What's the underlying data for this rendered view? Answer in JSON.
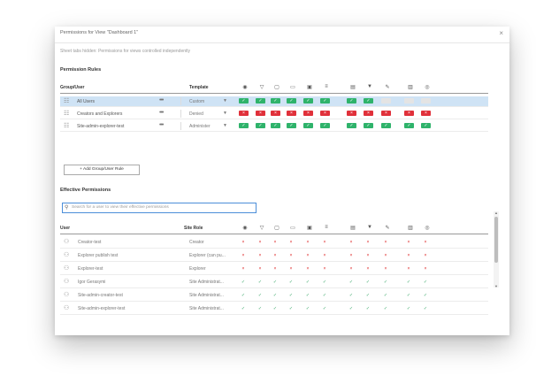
{
  "dialog": {
    "title": "Permissions for View \"Dashboard 1\"",
    "close_label": "×",
    "note": "Sheet tabs hidden: Permissions for views controlled independently"
  },
  "rules": {
    "section_title": "Permission Rules",
    "col_group": "Group/User",
    "col_template": "Template",
    "more_label": "•••",
    "caret": "▼",
    "capability_icons": [
      "view-icon",
      "filter-icon",
      "comment-icon",
      "add-comment-icon",
      "download-image-icon",
      "download-summary-icon",
      "download-full-data-icon",
      "share-icon",
      "web-edit-icon",
      "delete-icon",
      "set-permissions-icon"
    ],
    "rows": [
      {
        "name": "All Users",
        "template": "Custom",
        "selected": true,
        "caps": [
          "allow",
          "allow",
          "allow",
          "allow",
          "allow",
          "allow",
          "allow",
          "allow",
          "none",
          "none",
          "none"
        ]
      },
      {
        "name": "Creators and Explorers",
        "template": "Denied",
        "selected": false,
        "caps": [
          "deny",
          "deny",
          "deny",
          "deny",
          "deny",
          "deny",
          "deny",
          "deny",
          "deny",
          "deny",
          "deny"
        ]
      },
      {
        "name": "Site-admin-explorer-test",
        "template": "Administer",
        "selected": false,
        "caps": [
          "allow",
          "allow",
          "allow",
          "allow",
          "allow",
          "allow",
          "allow",
          "allow",
          "allow",
          "allow",
          "allow"
        ]
      }
    ],
    "add_button": "+ Add Group/User Rule"
  },
  "effective": {
    "section_title": "Effective Permissions",
    "search_placeholder": "Search for a user to view their effective permissions",
    "col_user": "User",
    "col_role": "Site Role",
    "rows": [
      {
        "name": "Creator-test",
        "role": "Creator",
        "marks": [
          "x",
          "x",
          "x",
          "x",
          "x",
          "x",
          "x",
          "x",
          "x",
          "x",
          "x"
        ]
      },
      {
        "name": "Explorer publish test",
        "role": "Explorer (can pu...",
        "marks": [
          "x",
          "x",
          "x",
          "x",
          "x",
          "x",
          "x",
          "x",
          "x",
          "x",
          "x"
        ]
      },
      {
        "name": "Explorer-test",
        "role": "Explorer",
        "marks": [
          "x",
          "x",
          "x",
          "x",
          "x",
          "x",
          "x",
          "x",
          "x",
          "x",
          "x"
        ]
      },
      {
        "name": "Igor Gerasymi",
        "role": "Site Administrat...",
        "marks": [
          "c",
          "c",
          "c",
          "c",
          "c",
          "c",
          "c",
          "c",
          "c",
          "c",
          "c"
        ]
      },
      {
        "name": "Site-admin-creator-test",
        "role": "Site Administrat...",
        "marks": [
          "c",
          "c",
          "c",
          "c",
          "c",
          "c",
          "c",
          "c",
          "c",
          "c",
          "c"
        ]
      },
      {
        "name": "Site-admin-explorer-test",
        "role": "Site Administrat...",
        "marks": [
          "c",
          "c",
          "c",
          "c",
          "c",
          "c",
          "c",
          "c",
          "c",
          "c",
          "c"
        ]
      }
    ]
  },
  "colors": {
    "allow": "#2fb36b",
    "deny": "#e0303a",
    "none": "#e4e4e4",
    "selected": "#cfe3f5"
  }
}
